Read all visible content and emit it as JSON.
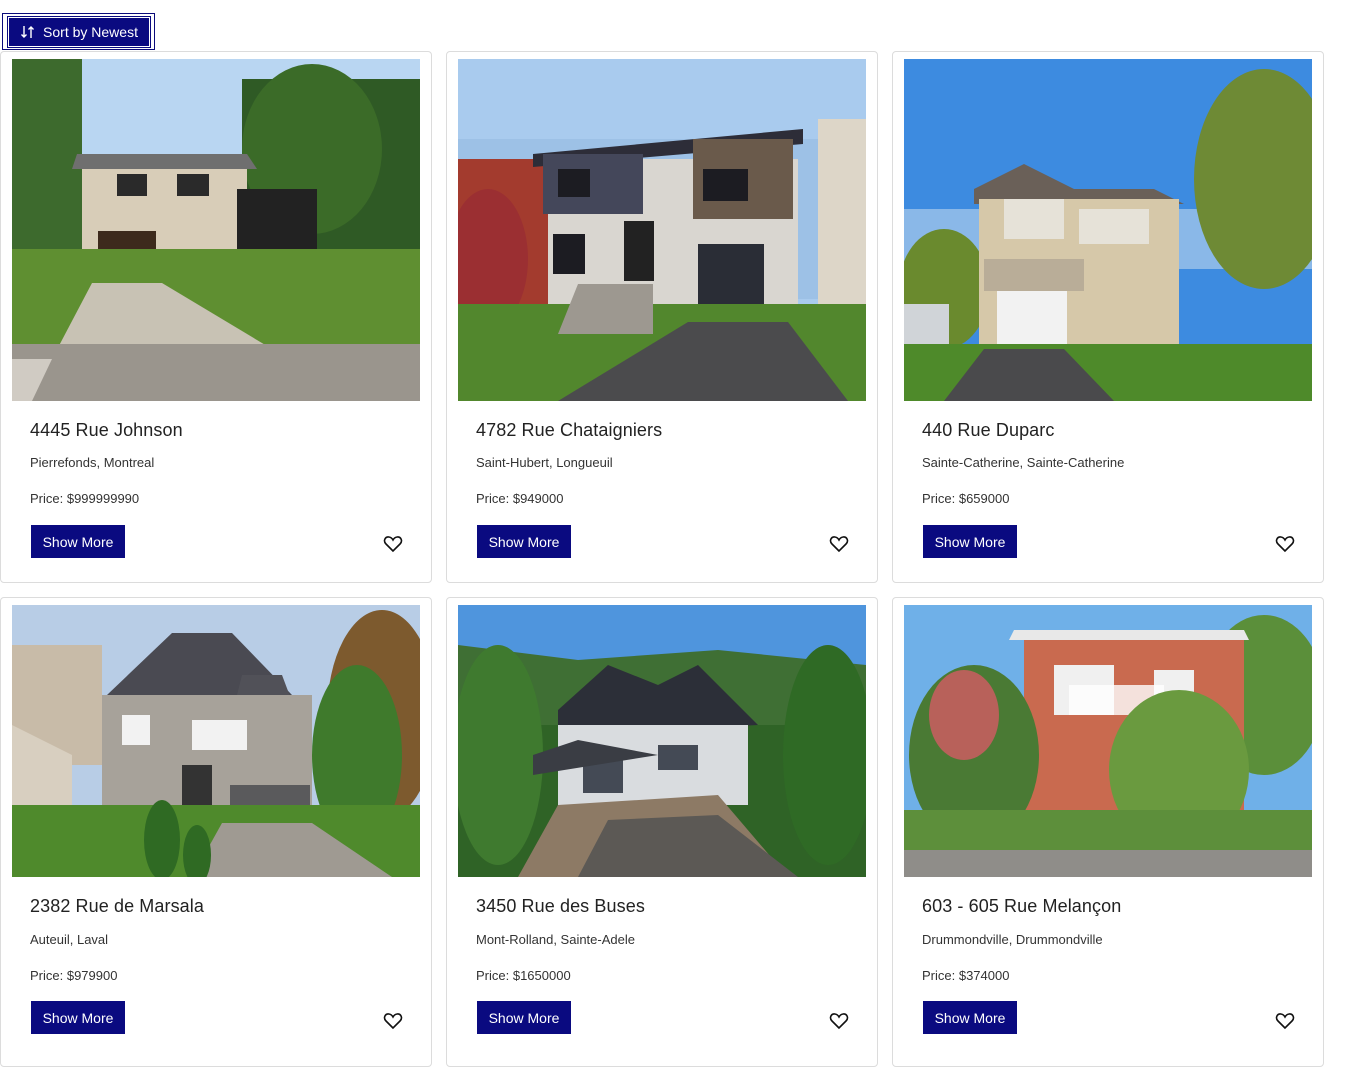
{
  "toolbar": {
    "sort_label": "Sort by Newest",
    "sort_icon": "sort-arrows-icon"
  },
  "listings": [
    {
      "title": "4445 Rue Johnson",
      "location": "Pierrefonds, Montreal",
      "price": "Price: $999999990",
      "button": "Show More",
      "icon": "heart-icon"
    },
    {
      "title": "4782 Rue Chataigniers",
      "location": "Saint-Hubert, Longueuil",
      "price": "Price: $949000",
      "button": "Show More",
      "icon": "heart-icon"
    },
    {
      "title": "440 Rue Duparc",
      "location": "Sainte-Catherine, Sainte-Catherine",
      "price": "Price: $659000",
      "button": "Show More",
      "icon": "heart-icon"
    },
    {
      "title": "2382 Rue de Marsala",
      "location": "Auteuil, Laval",
      "price": "Price: $979900",
      "button": "Show More",
      "icon": "heart-icon"
    },
    {
      "title": "3450 Rue des Buses",
      "location": "Mont-Rolland, Sainte-Adele",
      "price": "Price: $1650000",
      "button": "Show More",
      "icon": "heart-icon"
    },
    {
      "title": "603 - 605 Rue Melançon",
      "location": "Drummondville, Drummondville",
      "price": "Price: $374000",
      "button": "Show More",
      "icon": "heart-icon"
    }
  ],
  "colors": {
    "primary": "#0a0a80",
    "card_border": "#dcdcdc"
  }
}
